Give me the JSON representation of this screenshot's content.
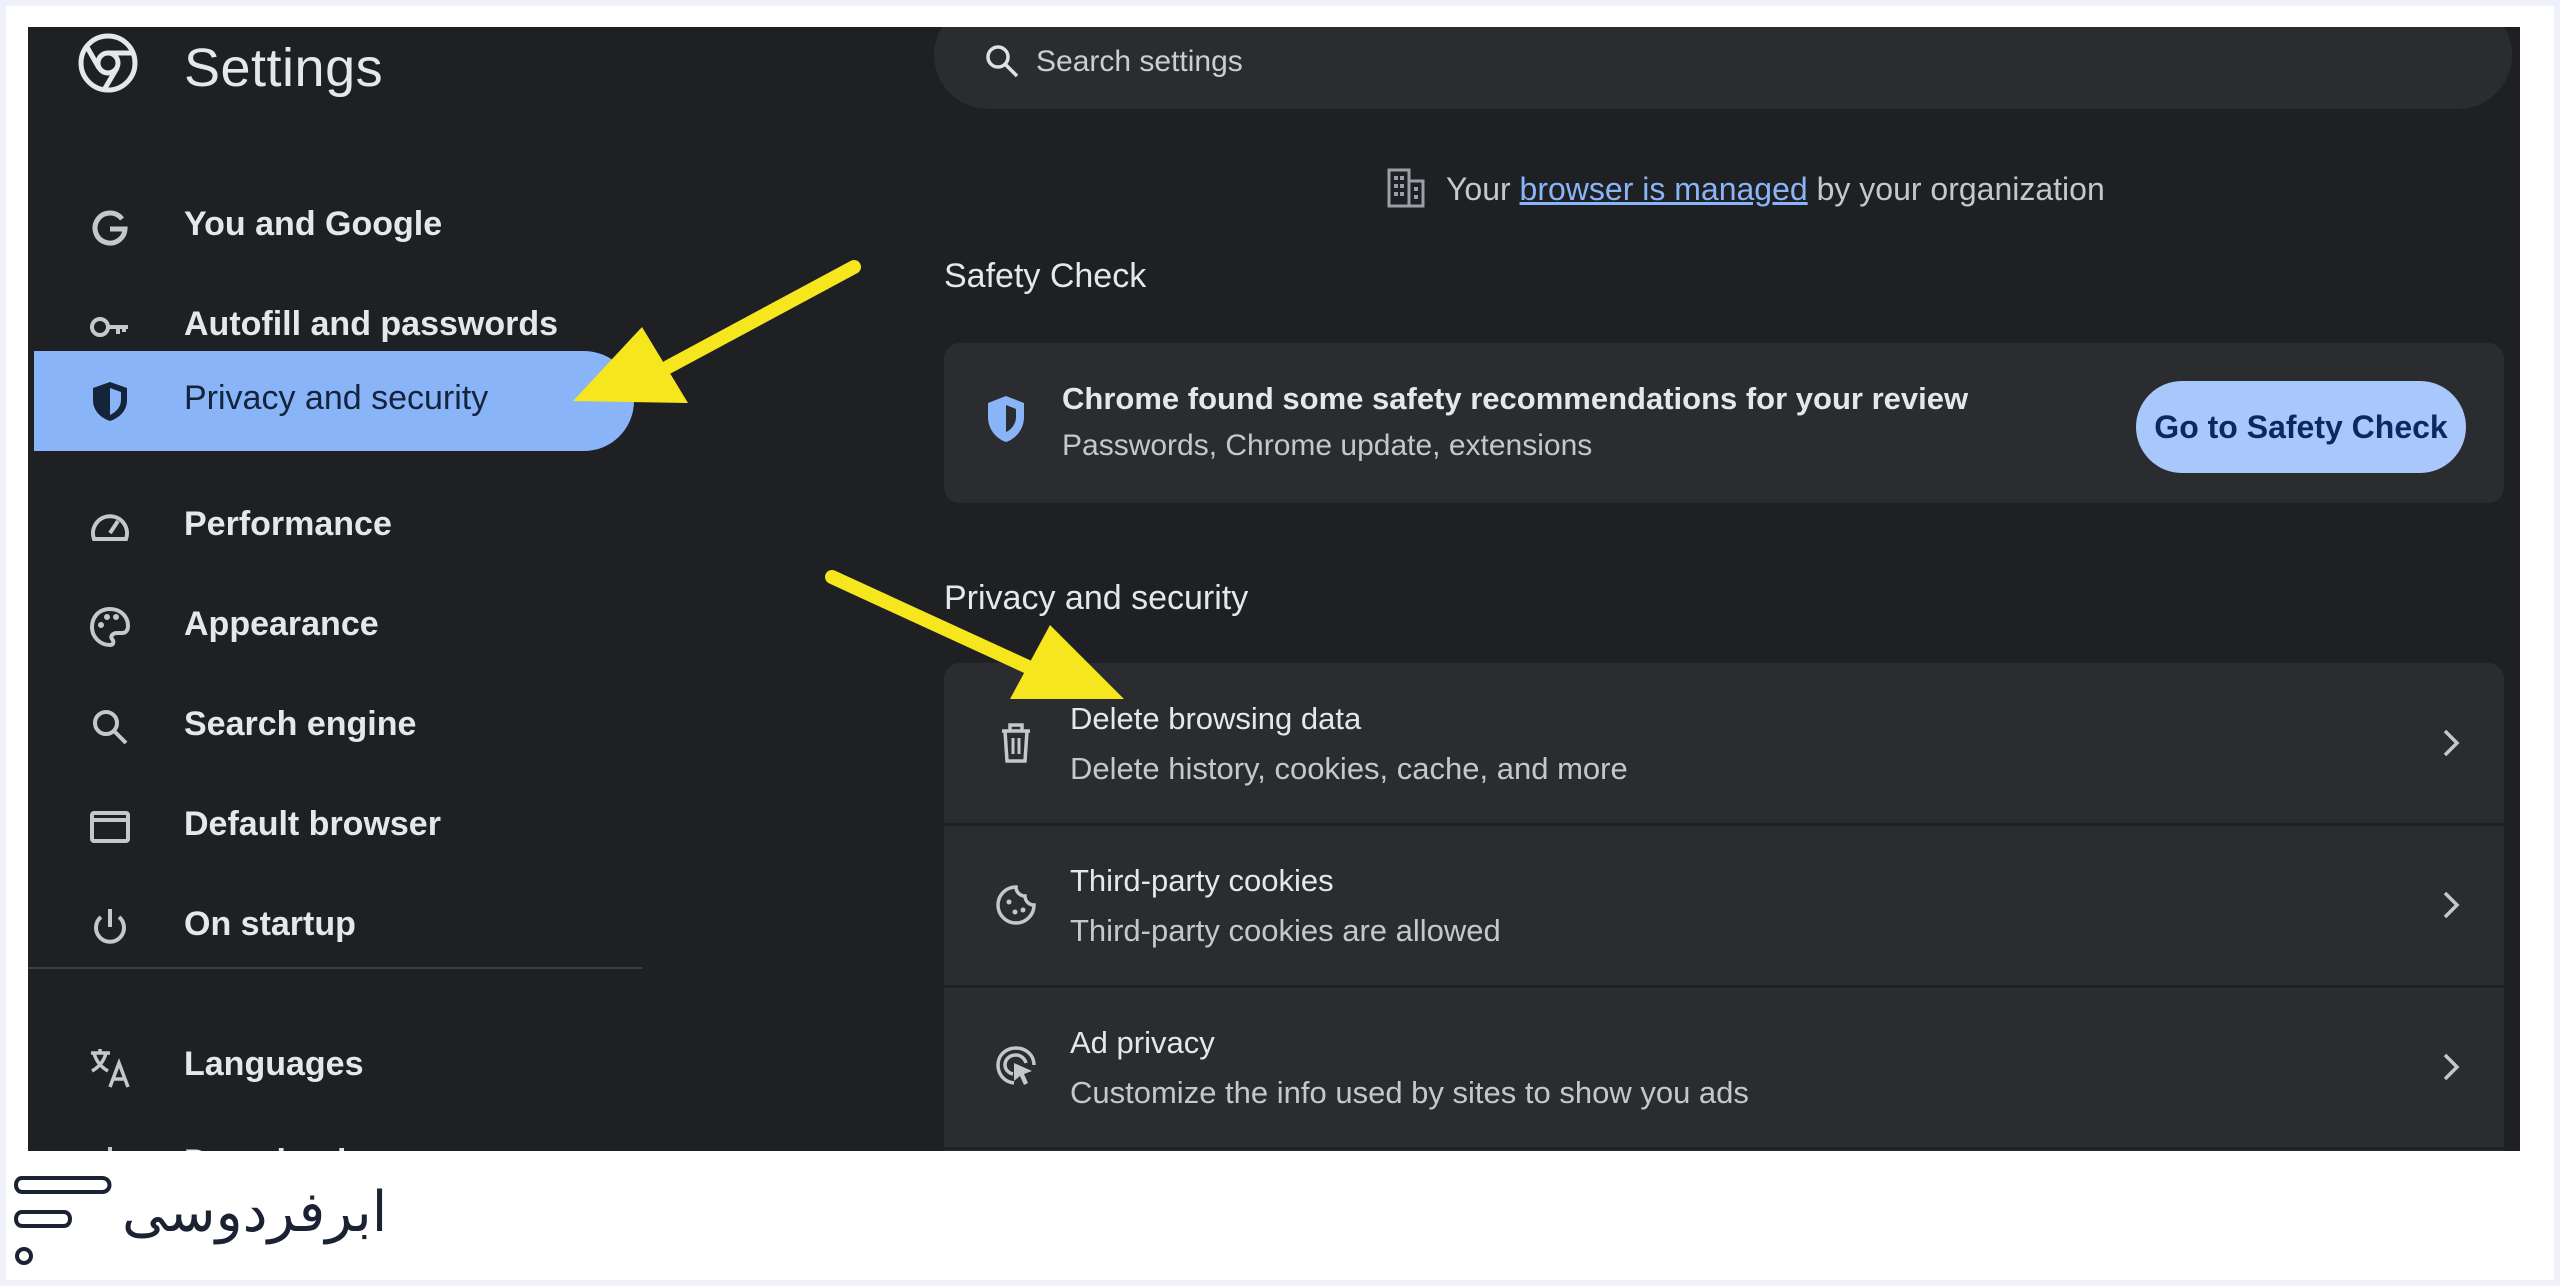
{
  "app": {
    "title": "Settings"
  },
  "search": {
    "placeholder": "Search settings"
  },
  "sidebar": {
    "items": [
      {
        "label": "You and Google",
        "icon": "google-g-icon"
      },
      {
        "label": "Autofill and passwords",
        "icon": "key-icon"
      },
      {
        "label": "Privacy and security",
        "icon": "shield-icon",
        "active": true
      },
      {
        "label": "Performance",
        "icon": "speedometer-icon"
      },
      {
        "label": "Appearance",
        "icon": "palette-icon"
      },
      {
        "label": "Search engine",
        "icon": "search-icon"
      },
      {
        "label": "Default browser",
        "icon": "browser-window-icon"
      },
      {
        "label": "On startup",
        "icon": "power-icon"
      },
      {
        "label": "Languages",
        "icon": "translate-icon"
      },
      {
        "label": "Downloads",
        "icon": "download-icon"
      }
    ]
  },
  "managed": {
    "prefix": "Your",
    "link": "browser is managed",
    "suffix": "by your organization"
  },
  "safety_check": {
    "section_title": "Safety Check",
    "title": "Chrome found some safety recommendations for your review",
    "subtitle": "Passwords, Chrome update, extensions",
    "button": "Go to Safety Check"
  },
  "privacy": {
    "section_title": "Privacy and security",
    "rows": [
      {
        "title": "Delete browsing data",
        "subtitle": "Delete history, cookies, cache, and more",
        "icon": "trash-icon"
      },
      {
        "title": "Third-party cookies",
        "subtitle": "Third-party cookies are allowed",
        "icon": "cookie-icon"
      },
      {
        "title": "Ad privacy",
        "subtitle": "Customize the info used by sites to show you ads",
        "icon": "ad-privacy-icon"
      }
    ]
  },
  "colors": {
    "background": "#1e2023",
    "card": "#2b2c2f",
    "accent": "#8ab4f8",
    "arrow": "#f5e61d"
  },
  "brand": {
    "text": "ابرفردوسی"
  }
}
